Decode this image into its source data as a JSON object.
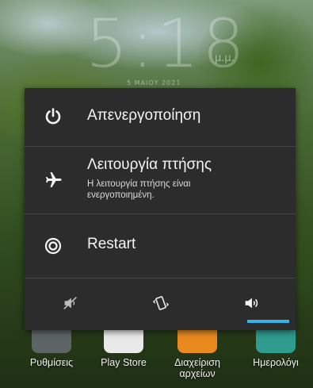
{
  "lockscreen": {
    "clock_time": "5:18",
    "ampm": "μ.μ.",
    "date": "5 ΜΑΙΟΥ 2021"
  },
  "power_menu": {
    "power_off": {
      "label": "Απενεργοποίηση",
      "icon": "power-icon"
    },
    "airplane": {
      "label": "Λειτουργία πτήσης",
      "status_line1": "Η λειτουργία πτήσης είναι",
      "status_line2": "ενεργοποιημένη.",
      "icon": "airplane-icon"
    },
    "restart": {
      "label": "Restart",
      "icon": "restart-icon"
    },
    "sound_modes": [
      {
        "name": "silent",
        "icon": "muted-speaker-icon"
      },
      {
        "name": "vibrate",
        "icon": "vibrate-phone-icon"
      },
      {
        "name": "sound",
        "icon": "speaker-icon",
        "selected": true
      }
    ],
    "accent_color": "#33b5e5"
  },
  "dock": {
    "apps": [
      {
        "label": "Ρυθμίσεις"
      },
      {
        "label": "Play Store"
      },
      {
        "label_line1": "Διαχείριση",
        "label_line2": "αρχείων"
      },
      {
        "label": "Ημερολόγι"
      }
    ]
  }
}
